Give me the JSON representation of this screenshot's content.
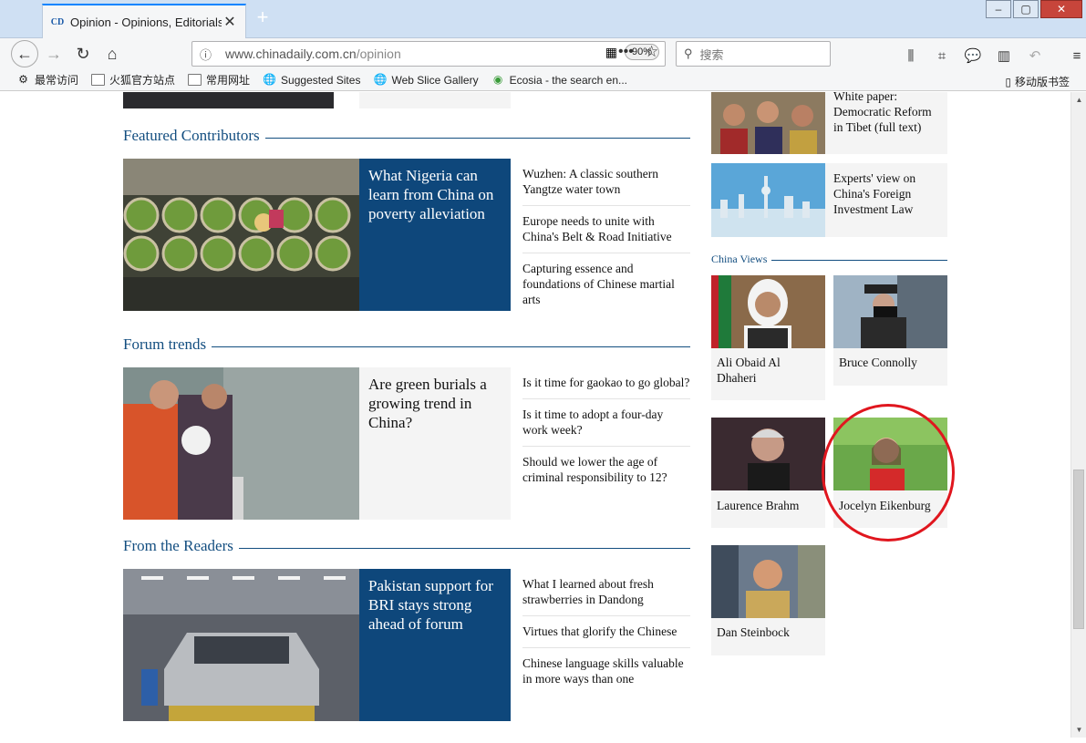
{
  "browser": {
    "tab_title": "Opinion - Opinions, Editorials, C",
    "tab_favicon": "CD",
    "url_host": "www.chinadaily.com.cn",
    "url_path": "/opinion",
    "zoom": "90%",
    "search_placeholder": "搜索",
    "bookmarks": [
      "最常访问",
      "火狐官方站点",
      "常用网址",
      "Suggested Sites",
      "Web Slice Gallery",
      "Ecosia - the search en..."
    ],
    "mobile_bookmarks": "移动版书签"
  },
  "sections": {
    "featured": {
      "title": "Featured Contributors",
      "main_headline": "What Nigeria can learn from China on poverty alleviation",
      "items": [
        "Wuzhen: A classic southern Yangtze water town",
        "Europe needs to unite with China's Belt & Road Initiative",
        "Capturing essence and foundations of Chinese martial arts"
      ]
    },
    "forum": {
      "title": "Forum trends",
      "main_headline": "Are green burials a growing trend in China?",
      "items": [
        "Is it time for gaokao to go global?",
        "Is it time to adopt a four-day work week?",
        "Should we lower the age of criminal responsibility to 12?"
      ]
    },
    "readers": {
      "title": "From the Readers",
      "main_headline": "Pakistan support for BRI stays strong ahead of forum",
      "items": [
        "What I learned about fresh strawberries in Dandong",
        "Virtues that glorify the Chinese",
        "Chinese language skills valuable in more ways than one"
      ]
    }
  },
  "right": {
    "promos": [
      "White paper: Democratic Reform in Tibet (full text)",
      "Experts' view on China's Foreign Investment Law"
    ],
    "china_views_title": "China Views",
    "contributors": [
      "Ali Obaid Al Dhaheri",
      "Bruce Connolly",
      "Laurence Brahm",
      "Jocelyn Eikenburg",
      "Dan Steinbock"
    ]
  }
}
